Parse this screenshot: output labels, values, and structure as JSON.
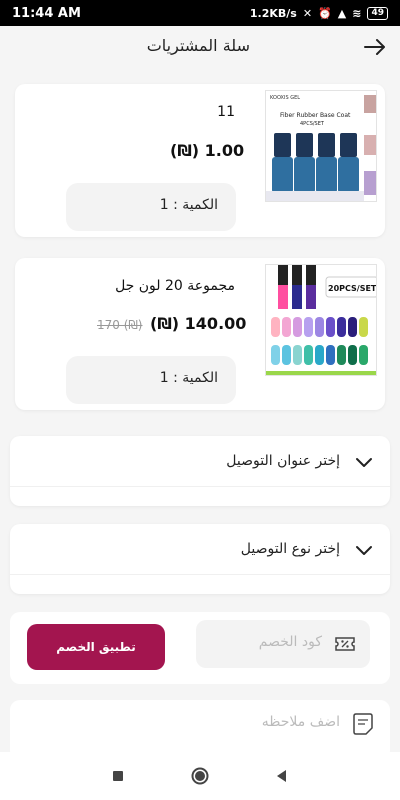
{
  "status_bar": {
    "time": "11:44 AM",
    "speed": "1.2KB/s",
    "battery": "49"
  },
  "header": {
    "title": "سلة المشتريات"
  },
  "cart_items": [
    {
      "name": "11",
      "price": "(₪) 1.00",
      "old_price": "",
      "quantity": "الكمية : 1",
      "image_text": {
        "brand": "KOOXIS GEL",
        "product": "Fiber Rubber Base Coat",
        "pack": "4PCS/SET"
      }
    },
    {
      "name": "مجموعة 20 لون جل",
      "price": "(₪) 140.00",
      "old_price": "170 (₪)",
      "quantity": "الكمية : 1",
      "image_text": {
        "badge": "20PCS/SET"
      }
    }
  ],
  "address_dropdown": {
    "label": "إختر عنوان التوصيل"
  },
  "delivery_dropdown": {
    "label": "إختر نوع التوصيل"
  },
  "discount": {
    "button_label": "تطبيق الخصم",
    "placeholder": "كود الخصم"
  },
  "note": {
    "placeholder": "اضف ملاحظه"
  },
  "colors": {
    "accent": "#a3154f",
    "background": "#f5f5f5"
  }
}
